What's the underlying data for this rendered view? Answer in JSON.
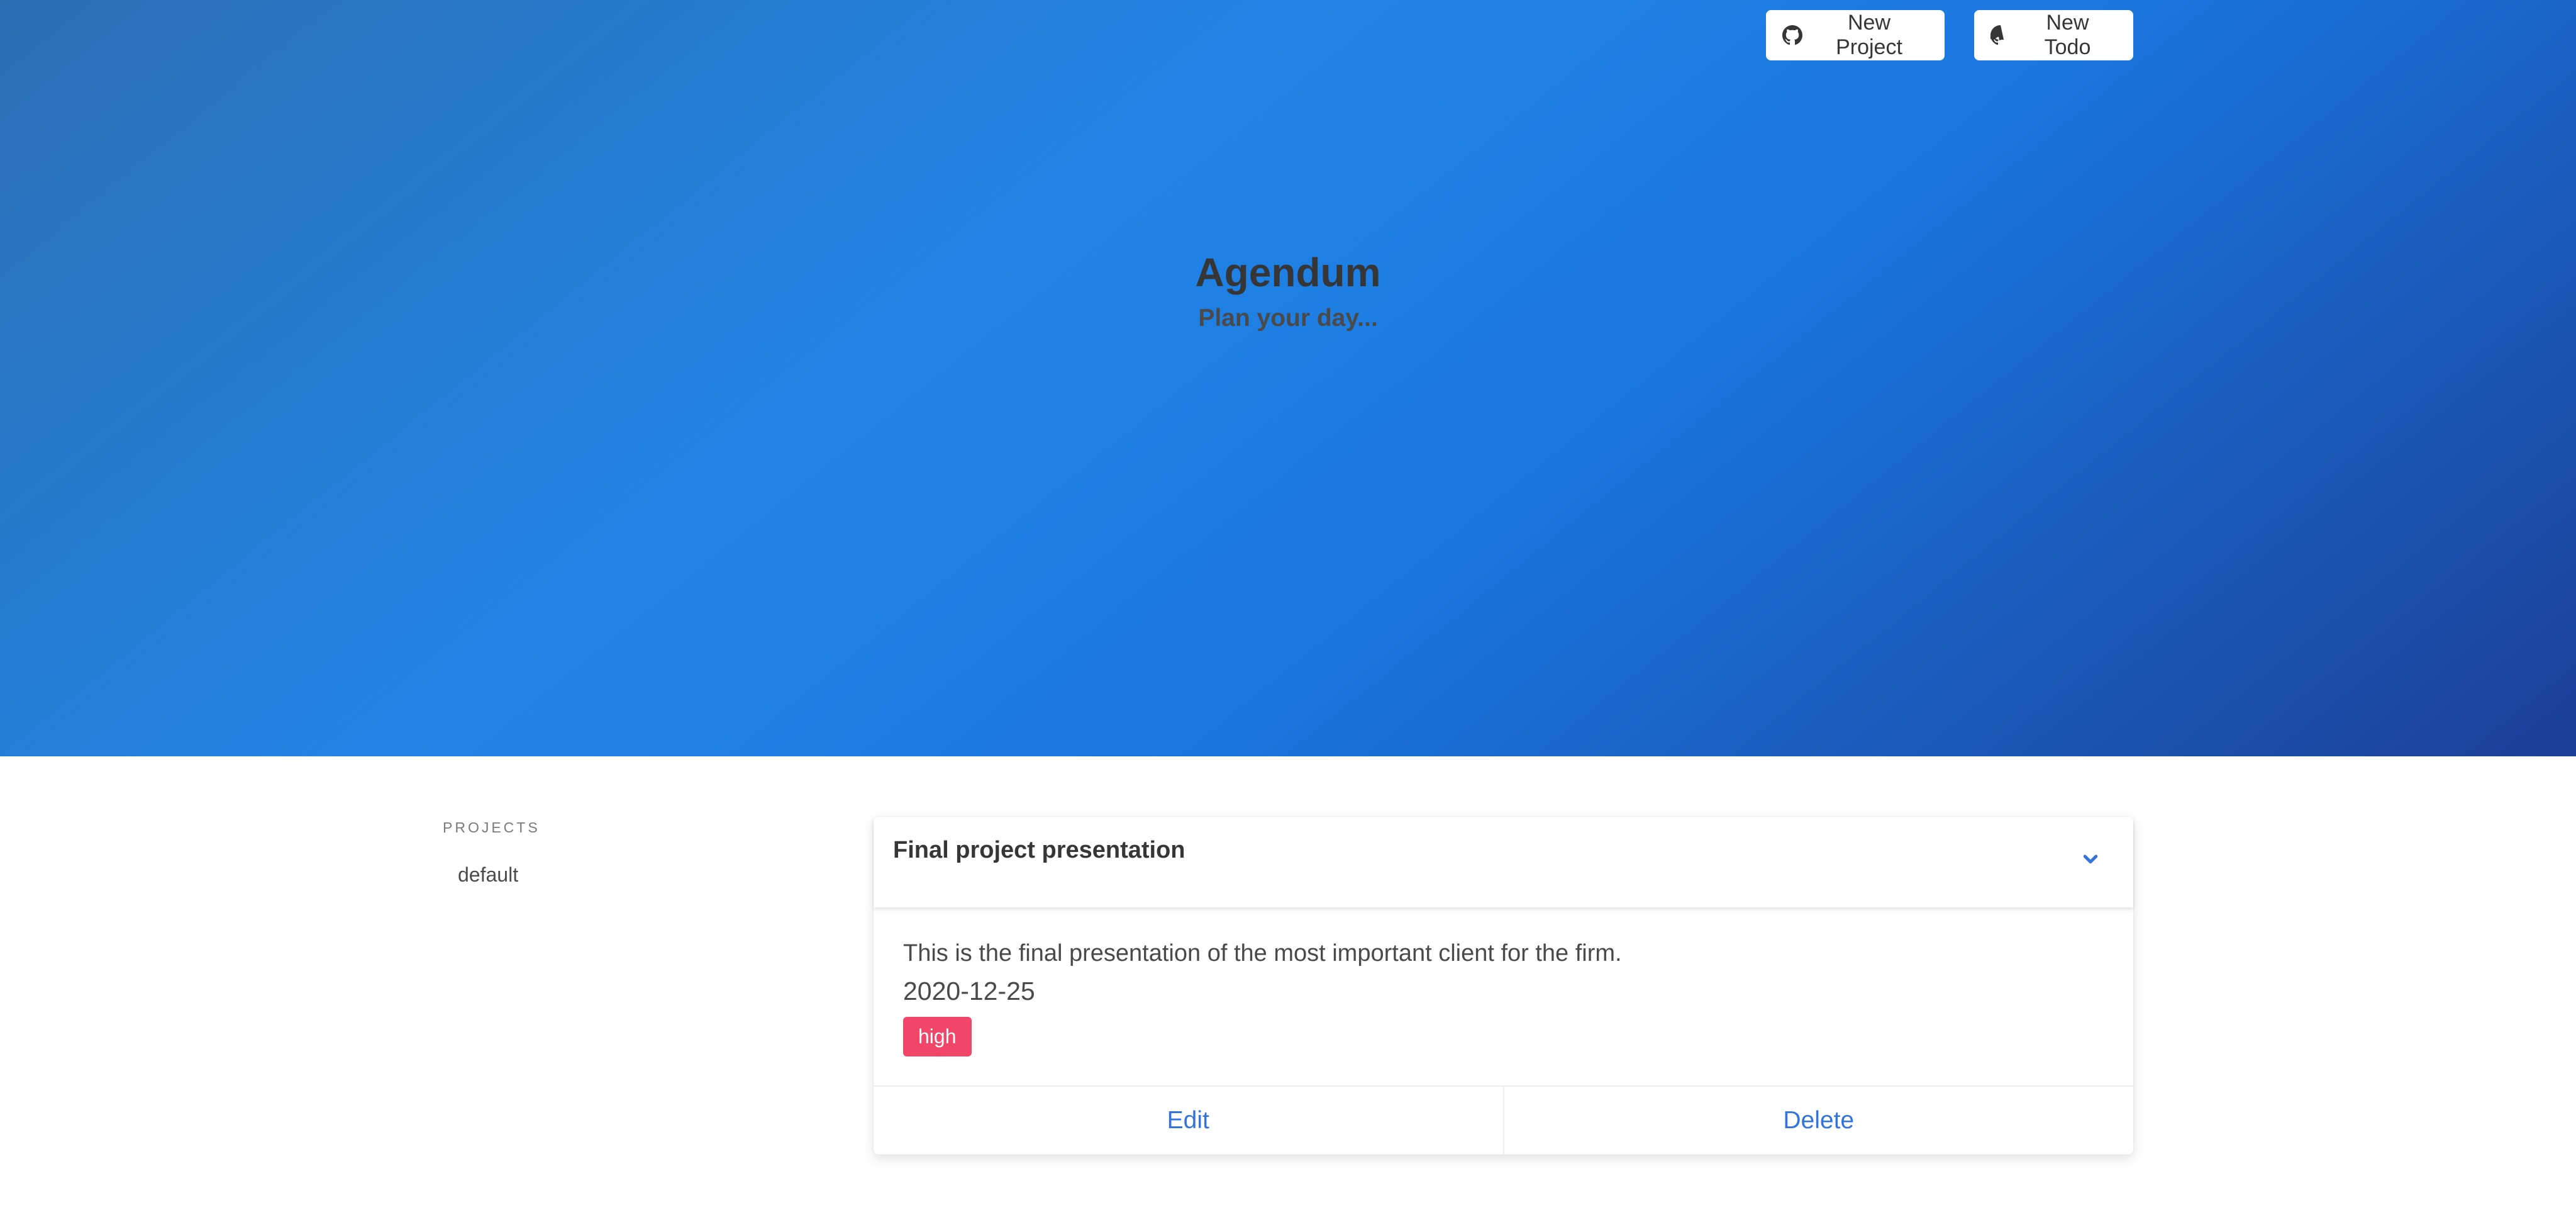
{
  "hero": {
    "title": "Agendum",
    "subtitle": "Plan your day..."
  },
  "nav": {
    "new_project_label": "New Project",
    "new_todo_label": "New Todo",
    "icon": "github-icon"
  },
  "sidebar": {
    "label": "PROJECTS",
    "items": [
      {
        "label": "default"
      }
    ]
  },
  "todos": [
    {
      "title": "Final project presentation",
      "description": "This is the final presentation of the most important client for the firm.",
      "date": "2020-12-25",
      "priority": "high",
      "toggle_icon": "chevron-down-icon",
      "edit_label": "Edit",
      "delete_label": "Delete"
    }
  ],
  "colors": {
    "hero_gradient": [
      "#2b6fb3",
      "#2285e6",
      "#1b3f97"
    ],
    "priority_high": "#f14668",
    "link": "#3273dc",
    "text": "#363636"
  }
}
